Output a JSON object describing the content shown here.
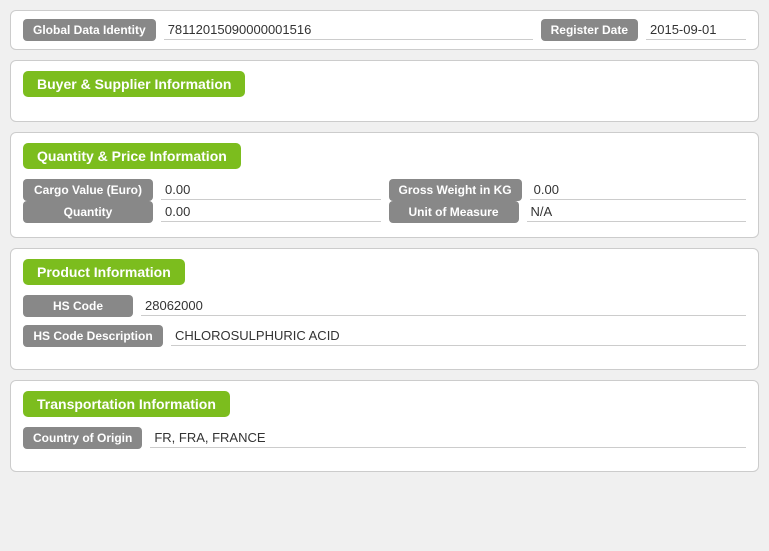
{
  "topBar": {
    "gdiLabel": "Global Data Identity",
    "gdiValue": "78112015090000001516",
    "registerLabel": "Register Date",
    "registerValue": "2015-09-01"
  },
  "buyerSupplierSection": {
    "title": "Buyer & Supplier Information"
  },
  "quantityPriceSection": {
    "title": "Quantity & Price Information",
    "cargoLabel": "Cargo Value (Euro)",
    "cargoValue": "0.00",
    "grossWeightLabel": "Gross Weight in KG",
    "grossWeightValue": "0.00",
    "quantityLabel": "Quantity",
    "quantityValue": "0.00",
    "unitMeasureLabel": "Unit of Measure",
    "unitMeasureValue": "N/A"
  },
  "productSection": {
    "title": "Product Information",
    "hsCodeLabel": "HS Code",
    "hsCodeValue": "28062000",
    "hsDescLabel": "HS Code Description",
    "hsDescValue": "CHLOROSULPHURIC ACID"
  },
  "transportSection": {
    "title": "Transportation Information",
    "countryOriginLabel": "Country of Origin",
    "countryOriginValue": "FR, FRA, FRANCE"
  }
}
